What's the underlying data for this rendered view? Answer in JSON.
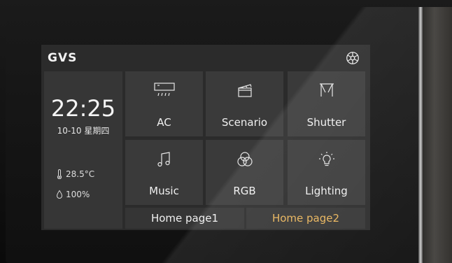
{
  "header": {
    "logo": "GVS"
  },
  "status": {
    "time": "22:25",
    "date": "10-10 星期四",
    "temperature": "28.5°C",
    "humidity": "100%"
  },
  "tiles": [
    {
      "label": "AC",
      "icon": "ac-icon"
    },
    {
      "label": "Scenario",
      "icon": "clapperboard-icon"
    },
    {
      "label": "Shutter",
      "icon": "curtain-icon"
    },
    {
      "label": "Music",
      "icon": "music-note-icon"
    },
    {
      "label": "RGB",
      "icon": "rgb-circles-icon"
    },
    {
      "label": "Lighting",
      "icon": "bulb-icon"
    }
  ],
  "pages": [
    {
      "label": "Home page1",
      "active": false
    },
    {
      "label": "Home page2",
      "active": true
    }
  ],
  "colors": {
    "accent": "#e9b45a",
    "screen_bg": "#2b2b2b",
    "tile_bg": "#3a3a3a"
  }
}
